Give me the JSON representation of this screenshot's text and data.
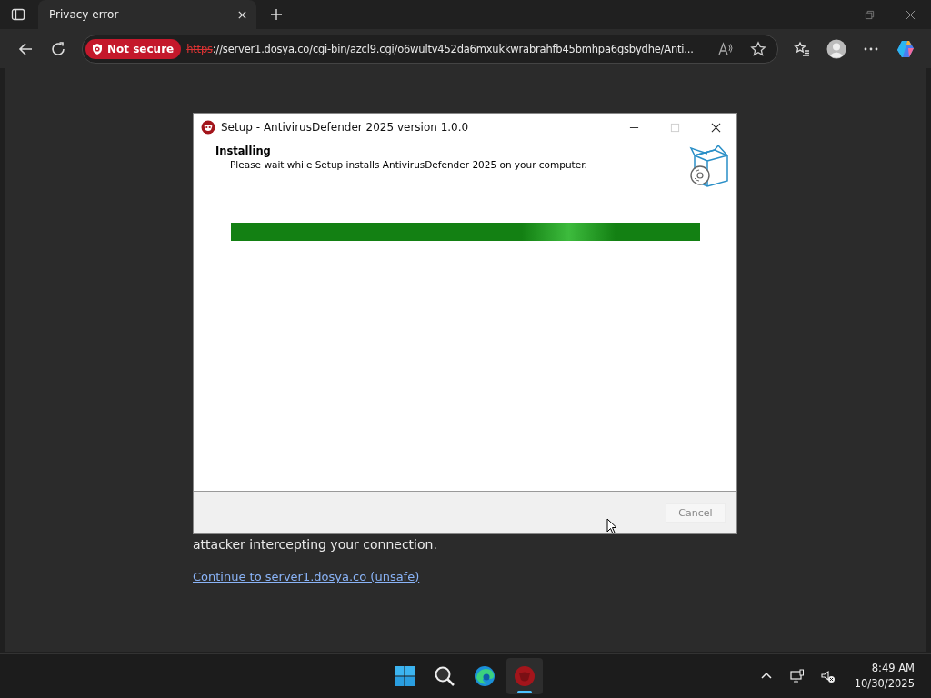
{
  "browser": {
    "tab": {
      "title": "Privacy error"
    },
    "address_bar": {
      "security_label": "Not secure",
      "url_scheme": "https",
      "url_rest": "://server1.dosya.co/cgi-bin/azcl9.cgi/o6wultv452da6mxukkwrabrahfb45bmhpa6gsbydhe/Anti..."
    }
  },
  "page": {
    "text": "attacker intercepting your connection.",
    "link": "Continue to server1.dosya.co (unsafe)"
  },
  "dialog": {
    "title": "Setup - AntivirusDefender 2025 version 1.0.0",
    "heading": "Installing",
    "description": "Please wait while Setup installs AntivirusDefender 2025 on your computer.",
    "progress": {
      "level": 1.0
    },
    "buttons": [
      {
        "label": "Cancel",
        "disabled": true
      }
    ]
  },
  "taskbar": {
    "apps": [
      {
        "kind": "start",
        "active": false
      },
      {
        "kind": "search",
        "active": false
      },
      {
        "kind": "edge",
        "active": false
      },
      {
        "kind": "setup",
        "active": true
      }
    ],
    "time": "8:49 AM",
    "date": "10/30/2025"
  }
}
